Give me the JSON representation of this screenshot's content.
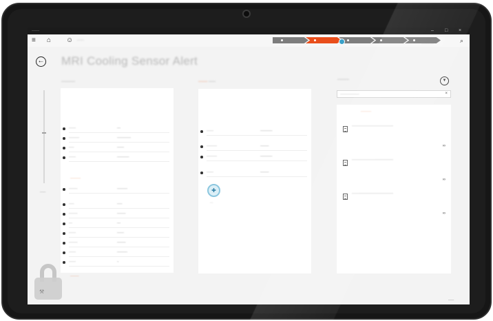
{
  "window": {
    "title": "––––",
    "minimize": "–",
    "restore": "□",
    "close": "×"
  },
  "nav": {
    "menu_icon": "≡",
    "home_icon": "⌂",
    "user_icon": "☺",
    "user_name": "–––",
    "search_icon": "⌕",
    "sub_label": "––––––––",
    "steps": [
      {
        "state": "done"
      },
      {
        "state": "active"
      },
      {
        "state": "pending"
      },
      {
        "state": "pending"
      },
      {
        "state": "pending"
      }
    ],
    "accent_color": "#e94e1b",
    "marker_color": "#3aa0c8"
  },
  "header": {
    "back_icon": "←",
    "title": "MRI Cooling Sensor Alert"
  },
  "rail": {
    "label": "–––"
  },
  "lock": {
    "icon": "lock-icon",
    "note_icon": "⚒"
  },
  "overview": {
    "heading": "––––––",
    "rows": [
      {
        "key": "––––",
        "value": "––"
      },
      {
        "key": "––––––",
        "value": "––––––––"
      },
      {
        "key": "–––",
        "value": "––––"
      },
      {
        "key": "––––",
        "value": "–––––––"
      }
    ],
    "section2": "––––––",
    "rows2": [
      {
        "key": "–––––",
        "value": "––––––"
      },
      {
        "key": "–––",
        "value": "–––"
      },
      {
        "key": "–––––",
        "value": "–––––"
      },
      {
        "key": "––",
        "value": "––"
      },
      {
        "key": "––––",
        "value": "––––"
      },
      {
        "key": "–––––",
        "value": "–––––"
      },
      {
        "key": "––––",
        "value": "––––––"
      },
      {
        "key": "––––",
        "value": "–"
      }
    ],
    "section3": "–––––",
    "note": "–––––––––––––––––––––"
  },
  "detail": {
    "heading_accent": "––––",
    "heading_rest": "–––",
    "rows": [
      {
        "key": "––––",
        "value": "–––––––"
      },
      {
        "key": "––––––",
        "value": "–––––"
      },
      {
        "key": "––––––",
        "value": "–––––––"
      },
      {
        "key": "––––",
        "value": "–––––"
      }
    ],
    "add_icon": "✚",
    "add_label": "––"
  },
  "knowledge": {
    "title": "–––––",
    "filter_icon": "▼",
    "search_placeholder": "–––––––––––",
    "clear_icon": "×",
    "section": "––––––",
    "articles": [
      {
        "text": "––––––––––––––––––––––––",
        "link_icon": "∞"
      },
      {
        "text": "––––––––––––––––––––––––",
        "link_icon": "∞"
      },
      {
        "text": "––––––––––––––––––––––––",
        "link_icon": "∞"
      }
    ]
  },
  "footer": {
    "mark": "–––"
  }
}
